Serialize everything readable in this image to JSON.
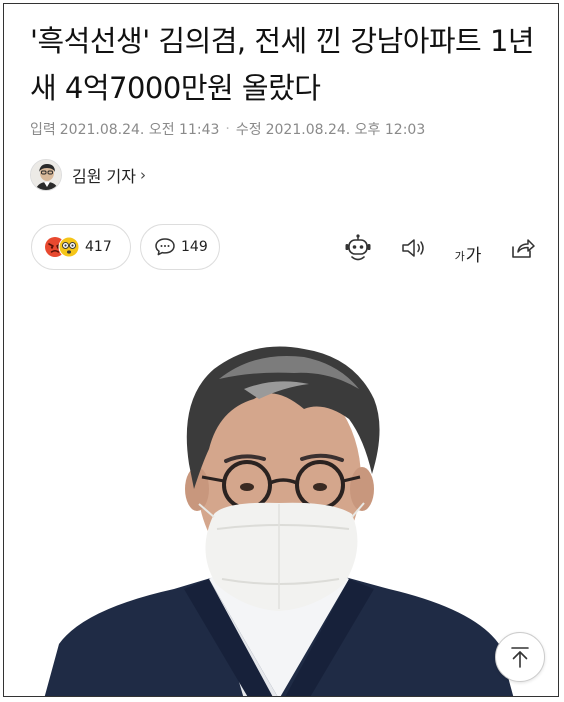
{
  "article": {
    "title": "'흑석선생' 김의겸, 전세 낀 강남아파트 1년새 4억7000만원 올랐다",
    "published_label": "입력",
    "published": "2021.08.24. 오전 11:43",
    "modified_label": "수정",
    "modified": "2021.08.24. 오후 12:03",
    "author": "김원 기자",
    "author_chevron": "›"
  },
  "engagement": {
    "reactions_count": "417",
    "comments_count": "149"
  },
  "toolbar": {
    "font_size_small": "가",
    "font_size_large": "가"
  },
  "colors": {
    "text": "#111111",
    "meta": "#8a8a8a",
    "border": "#dddddd",
    "angry": "#e8492f",
    "surprised": "#f5c518"
  },
  "icons": [
    "angry-emoji-icon",
    "surprised-emoji-icon",
    "comment-icon",
    "robot-summary-icon",
    "speaker-icon",
    "font-size-icon",
    "share-icon",
    "arrow-up-icon"
  ]
}
